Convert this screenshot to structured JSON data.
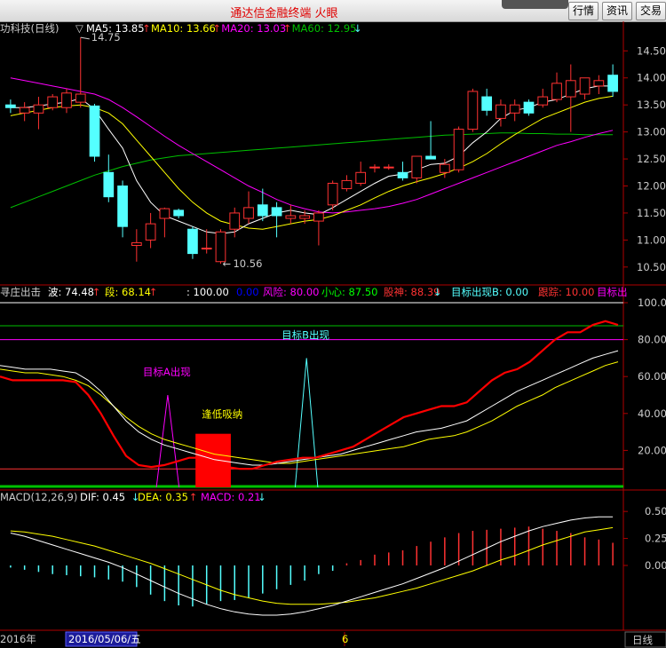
{
  "window": {
    "title": "通达信金融终端 火眼",
    "buttons": [
      "行情",
      "资讯",
      "交易"
    ]
  },
  "colors": {
    "up": "#ff3232",
    "down": "#54ffff",
    "ma5": "#ffffff",
    "ma10": "#ffff00",
    "ma20": "#ff00ff",
    "ma60": "#00c000",
    "axis": "#b00000",
    "label": "#cccccc"
  },
  "price_panel": {
    "name": "功科技(日线)",
    "indicators": [
      {
        "label": "MA5: 13.85",
        "arrow": "↑",
        "color": "#ffffff"
      },
      {
        "label": "MA10: 13.66",
        "arrow": "↑",
        "color": "#ffff00"
      },
      {
        "label": "MA20: 13.03",
        "arrow": "↑",
        "color": "#ff00ff"
      },
      {
        "label": "MA60: 12.95",
        "arrow": "↓",
        "color": "#00c000"
      }
    ],
    "high_marker": "14.75",
    "low_marker": "10.56",
    "y_ticks": [
      "14.50",
      "14.00",
      "13.50",
      "13.00",
      "12.50",
      "12.00",
      "11.50",
      "11.00",
      "10.50"
    ]
  },
  "indicator_panel": {
    "name": "寻庄出击",
    "labels": [
      {
        "text": "波: 74.48",
        "arrow": "↑",
        "color": "#ffffff"
      },
      {
        "text": "段: 68.14",
        "arrow": "↑",
        "color": "#ffff00"
      },
      {
        "text": ": 100.00",
        "arrow": "",
        "color": "#ffffff"
      },
      {
        "text": "0.00",
        "arrow": "",
        "color": "#0000ff"
      },
      {
        "text": "风险: 80.00",
        "arrow": "",
        "color": "#ff00ff"
      },
      {
        "text": "小心: 87.50",
        "arrow": "",
        "color": "#00ff00"
      },
      {
        "text": "股神: 88.39",
        "arrow": "↓",
        "color": "#ff3232"
      },
      {
        "text": "目标出现B: 0.00",
        "arrow": "",
        "color": "#54ffff"
      },
      {
        "text": "跟踪: 10.00",
        "arrow": "",
        "color": "#ff3232"
      },
      {
        "text": "目标出",
        "arrow": "",
        "color": "#ff00ff"
      }
    ],
    "annotations": {
      "target_a": "目标A出现",
      "target_b": "目标B出现",
      "dip_buy": "逢低吸纳"
    },
    "y_ticks": [
      "100.00",
      "80.00",
      "60.00",
      "40.00",
      "20.00"
    ]
  },
  "macd_panel": {
    "name": "MACD(12,26,9)",
    "labels": [
      {
        "text": "DIF: 0.45",
        "arrow": "↓",
        "color": "#ffffff"
      },
      {
        "text": "DEA: 0.35",
        "arrow": "↑",
        "color": "#ffff00"
      },
      {
        "text": "MACD: 0.21",
        "arrow": "↓",
        "color": "#ff00ff"
      }
    ],
    "y_ticks": [
      "0.50",
      "0.25",
      "0.00"
    ]
  },
  "time_axis": {
    "year": "2016年",
    "cursor_date": "2016/05/06/五",
    "month": "6",
    "period": "日线"
  },
  "chart_data": [
    {
      "type": "candlestick",
      "title": "功科技(日线)",
      "ylim": [
        10.3,
        14.85
      ],
      "candles": [
        {
          "o": 13.5,
          "h": 13.6,
          "l": 13.35,
          "c": 13.45
        },
        {
          "o": 13.35,
          "h": 13.55,
          "l": 13.2,
          "c": 13.45
        },
        {
          "o": 13.35,
          "h": 13.65,
          "l": 13.05,
          "c": 13.5
        },
        {
          "o": 13.45,
          "h": 13.7,
          "l": 13.4,
          "c": 13.65
        },
        {
          "o": 13.45,
          "h": 13.8,
          "l": 13.35,
          "c": 13.72
        },
        {
          "o": 13.55,
          "h": 14.75,
          "l": 13.45,
          "c": 13.7
        },
        {
          "o": 13.48,
          "h": 13.52,
          "l": 12.45,
          "c": 12.55
        },
        {
          "o": 12.25,
          "h": 12.58,
          "l": 11.7,
          "c": 11.8
        },
        {
          "o": 12.0,
          "h": 12.1,
          "l": 11.05,
          "c": 11.25
        },
        {
          "o": 10.9,
          "h": 11.2,
          "l": 10.6,
          "c": 10.95
        },
        {
          "o": 11.0,
          "h": 11.5,
          "l": 10.85,
          "c": 11.3
        },
        {
          "o": 11.4,
          "h": 11.6,
          "l": 11.05,
          "c": 11.58
        },
        {
          "o": 11.55,
          "h": 11.58,
          "l": 11.4,
          "c": 11.45
        },
        {
          "o": 11.2,
          "h": 11.25,
          "l": 10.65,
          "c": 10.75
        },
        {
          "o": 10.85,
          "h": 11.2,
          "l": 10.75,
          "c": 10.85
        },
        {
          "o": 10.6,
          "h": 11.2,
          "l": 10.56,
          "c": 11.15
        },
        {
          "o": 11.2,
          "h": 11.6,
          "l": 11.05,
          "c": 11.5
        },
        {
          "o": 11.4,
          "h": 11.9,
          "l": 11.3,
          "c": 11.6
        },
        {
          "o": 11.65,
          "h": 11.95,
          "l": 11.35,
          "c": 11.45
        },
        {
          "o": 11.6,
          "h": 11.7,
          "l": 11.05,
          "c": 11.45
        },
        {
          "o": 11.4,
          "h": 11.65,
          "l": 11.3,
          "c": 11.45
        },
        {
          "o": 11.4,
          "h": 11.55,
          "l": 11.3,
          "c": 11.45
        },
        {
          "o": 11.35,
          "h": 11.55,
          "l": 10.9,
          "c": 11.5
        },
        {
          "o": 11.65,
          "h": 12.1,
          "l": 11.55,
          "c": 12.05
        },
        {
          "o": 11.95,
          "h": 12.2,
          "l": 11.9,
          "c": 12.1
        },
        {
          "o": 12.05,
          "h": 12.45,
          "l": 12.0,
          "c": 12.25
        },
        {
          "o": 12.35,
          "h": 12.4,
          "l": 12.25,
          "c": 12.35
        },
        {
          "o": 12.35,
          "h": 12.4,
          "l": 12.3,
          "c": 12.35
        },
        {
          "o": 12.25,
          "h": 12.45,
          "l": 12.1,
          "c": 12.15
        },
        {
          "o": 12.15,
          "h": 12.55,
          "l": 12.05,
          "c": 12.55
        },
        {
          "o": 12.55,
          "h": 13.2,
          "l": 12.5,
          "c": 12.5
        },
        {
          "o": 12.25,
          "h": 12.5,
          "l": 12.15,
          "c": 12.4
        },
        {
          "o": 12.3,
          "h": 13.1,
          "l": 12.25,
          "c": 13.05
        },
        {
          "o": 13.05,
          "h": 13.8,
          "l": 13.0,
          "c": 13.75
        },
        {
          "o": 13.65,
          "h": 13.8,
          "l": 13.3,
          "c": 13.4
        },
        {
          "o": 13.25,
          "h": 13.6,
          "l": 13.1,
          "c": 13.5
        },
        {
          "o": 13.35,
          "h": 13.6,
          "l": 13.2,
          "c": 13.5
        },
        {
          "o": 13.55,
          "h": 13.6,
          "l": 13.3,
          "c": 13.35
        },
        {
          "o": 13.5,
          "h": 13.8,
          "l": 13.45,
          "c": 13.65
        },
        {
          "o": 13.6,
          "h": 14.1,
          "l": 13.55,
          "c": 13.9
        },
        {
          "o": 13.65,
          "h": 14.25,
          "l": 13.0,
          "c": 13.95
        },
        {
          "o": 13.7,
          "h": 14.0,
          "l": 13.6,
          "c": 14.0
        },
        {
          "o": 13.85,
          "h": 14.05,
          "l": 13.7,
          "c": 13.95
        },
        {
          "o": 14.05,
          "h": 14.25,
          "l": 13.65,
          "c": 13.75
        }
      ],
      "ma5": [
        13.45,
        13.45,
        13.48,
        13.52,
        13.55,
        13.62,
        13.42,
        13.05,
        12.7,
        12.1,
        11.7,
        11.45,
        11.35,
        11.25,
        11.15,
        11.12,
        11.15,
        11.3,
        11.4,
        11.5,
        11.55,
        11.5,
        11.47,
        11.6,
        11.75,
        11.9,
        12.05,
        12.18,
        12.22,
        12.3,
        12.4,
        12.42,
        12.55,
        12.8,
        13.0,
        13.25,
        13.4,
        13.45,
        13.55,
        13.6,
        13.7,
        13.8,
        13.85,
        13.85
      ],
      "ma10": [
        13.3,
        13.35,
        13.4,
        13.45,
        13.48,
        13.5,
        13.45,
        13.35,
        13.15,
        12.85,
        12.55,
        12.25,
        11.95,
        11.7,
        11.5,
        11.35,
        11.28,
        11.22,
        11.2,
        11.25,
        11.3,
        11.35,
        11.38,
        11.45,
        11.55,
        11.65,
        11.78,
        11.9,
        12.0,
        12.08,
        12.15,
        12.23,
        12.33,
        12.45,
        12.6,
        12.78,
        12.95,
        13.1,
        13.25,
        13.35,
        13.45,
        13.55,
        13.62,
        13.66
      ],
      "ma20": [
        14.0,
        13.95,
        13.9,
        13.85,
        13.8,
        13.75,
        13.7,
        13.6,
        13.45,
        13.28,
        13.1,
        12.92,
        12.75,
        12.6,
        12.45,
        12.3,
        12.15,
        12.0,
        11.88,
        11.75,
        11.65,
        11.58,
        11.52,
        11.5,
        11.52,
        11.55,
        11.58,
        11.62,
        11.68,
        11.75,
        11.85,
        11.95,
        12.05,
        12.15,
        12.25,
        12.35,
        12.45,
        12.55,
        12.65,
        12.75,
        12.82,
        12.9,
        12.97,
        13.03
      ],
      "ma60": [
        11.6,
        11.7,
        11.8,
        11.9,
        12.0,
        12.1,
        12.2,
        12.28,
        12.36,
        12.42,
        12.48,
        12.52,
        12.56,
        12.58,
        12.6,
        12.62,
        12.64,
        12.66,
        12.68,
        12.7,
        12.72,
        12.74,
        12.76,
        12.78,
        12.8,
        12.82,
        12.84,
        12.86,
        12.88,
        12.9,
        12.92,
        12.94,
        12.95,
        12.96,
        12.97,
        12.98,
        12.98,
        12.97,
        12.97,
        12.96,
        12.96,
        12.95,
        12.95,
        12.95
      ]
    },
    {
      "type": "line",
      "title": "寻庄出击",
      "ylim": [
        0,
        100
      ],
      "series": [
        {
          "name": "股神",
          "values": [
            60,
            58,
            58,
            58,
            58,
            58,
            57,
            50,
            40,
            28,
            17,
            12,
            11,
            12,
            14,
            16,
            16,
            14,
            11,
            10,
            10,
            12,
            14,
            15,
            16,
            16,
            18,
            20,
            22,
            26,
            30,
            34,
            38,
            40,
            42,
            44,
            44,
            46,
            52,
            58,
            62,
            64,
            68,
            74,
            80,
            84,
            84,
            88,
            90,
            88
          ]
        },
        {
          "name": "波",
          "values": [
            66,
            65,
            64,
            64,
            64,
            63,
            62,
            58,
            52,
            44,
            36,
            30,
            26,
            23,
            21,
            19,
            17,
            15,
            14,
            13,
            12,
            12,
            13,
            14,
            15,
            16,
            17,
            18,
            20,
            22,
            24,
            26,
            28,
            30,
            31,
            32,
            34,
            36,
            40,
            44,
            48,
            52,
            55,
            58,
            61,
            64,
            67,
            70,
            72,
            74
          ]
        },
        {
          "name": "段",
          "values": [
            64,
            63,
            62,
            62,
            61,
            60,
            58,
            55,
            50,
            44,
            38,
            33,
            29,
            26,
            24,
            22,
            20,
            18,
            17,
            16,
            15,
            14,
            13,
            13,
            14,
            15,
            16,
            17,
            18,
            19,
            20,
            21,
            22,
            24,
            26,
            27,
            28,
            30,
            33,
            36,
            40,
            44,
            47,
            50,
            54,
            57,
            60,
            63,
            66,
            68
          ]
        },
        {
          "name": "风险",
          "values": [
            80,
            80
          ]
        },
        {
          "name": "小心",
          "values": [
            87.5,
            87.5
          ]
        },
        {
          "name": "跟踪",
          "values": [
            10,
            10
          ]
        }
      ],
      "signals": [
        {
          "name": "目标A出现",
          "index": 12,
          "peak": 50
        },
        {
          "name": "目标B出现",
          "index": 23,
          "peak": 70
        },
        {
          "name": "逢低吸纳",
          "from": 15,
          "to": 17,
          "low": 0,
          "high": 29
        }
      ]
    },
    {
      "type": "macd",
      "title": "MACD(12,26,9)",
      "ylim": [
        -0.6,
        0.6
      ],
      "dif": [
        0.3,
        0.27,
        0.23,
        0.19,
        0.15,
        0.11,
        0.07,
        0.03,
        -0.02,
        -0.08,
        -0.14,
        -0.2,
        -0.26,
        -0.31,
        -0.36,
        -0.4,
        -0.43,
        -0.45,
        -0.46,
        -0.46,
        -0.45,
        -0.43,
        -0.4,
        -0.37,
        -0.33,
        -0.29,
        -0.25,
        -0.21,
        -0.17,
        -0.12,
        -0.07,
        -0.02,
        0.04,
        0.1,
        0.16,
        0.22,
        0.27,
        0.32,
        0.36,
        0.39,
        0.42,
        0.44,
        0.45,
        0.45
      ],
      "dea": [
        0.32,
        0.31,
        0.29,
        0.27,
        0.24,
        0.21,
        0.18,
        0.14,
        0.1,
        0.06,
        0.02,
        -0.03,
        -0.08,
        -0.13,
        -0.18,
        -0.23,
        -0.27,
        -0.3,
        -0.33,
        -0.35,
        -0.36,
        -0.36,
        -0.36,
        -0.35,
        -0.34,
        -0.32,
        -0.3,
        -0.27,
        -0.24,
        -0.21,
        -0.17,
        -0.13,
        -0.09,
        -0.05,
        0.0,
        0.05,
        0.09,
        0.14,
        0.19,
        0.23,
        0.27,
        0.31,
        0.33,
        0.35
      ],
      "macd": [
        -0.02,
        -0.04,
        -0.06,
        -0.08,
        -0.09,
        -0.1,
        -0.11,
        -0.13,
        -0.15,
        -0.2,
        -0.27,
        -0.33,
        -0.37,
        -0.38,
        -0.36,
        -0.33,
        -0.32,
        -0.3,
        -0.26,
        -0.22,
        -0.18,
        -0.14,
        -0.08,
        -0.05,
        0.02,
        0.05,
        0.1,
        0.12,
        0.14,
        0.18,
        0.22,
        0.26,
        0.3,
        0.32,
        0.33,
        0.34,
        0.35,
        0.36,
        0.34,
        0.32,
        0.3,
        0.26,
        0.24,
        0.21
      ]
    }
  ]
}
